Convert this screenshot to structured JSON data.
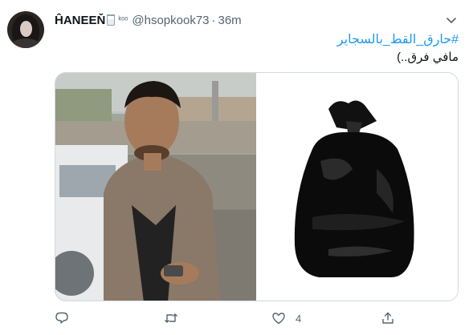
{
  "tweet": {
    "author": {
      "display_name": "ĤANEEŇ",
      "name_suffix": "ᵏᵒᵒ",
      "handle": "@hsopkook73"
    },
    "separator": "·",
    "time": "36m",
    "hashtag": "#حارق_القط_بالسجاير",
    "text": "مافي فرق..)",
    "media": {
      "left_image": "photo-man-in-jacket",
      "right_image": "photo-black-trash-bag"
    },
    "actions": {
      "reply_count": "",
      "retweet_count": "",
      "like_count": "4",
      "share_count": ""
    },
    "icons": {
      "caret": "chevron-down-icon",
      "reply": "reply-icon",
      "retweet": "retweet-icon",
      "like": "heart-icon",
      "share": "share-icon"
    },
    "colors": {
      "link": "#1d9bf0",
      "secondary": "#536471",
      "text": "#0f1419",
      "border": "#cfd9de"
    }
  }
}
